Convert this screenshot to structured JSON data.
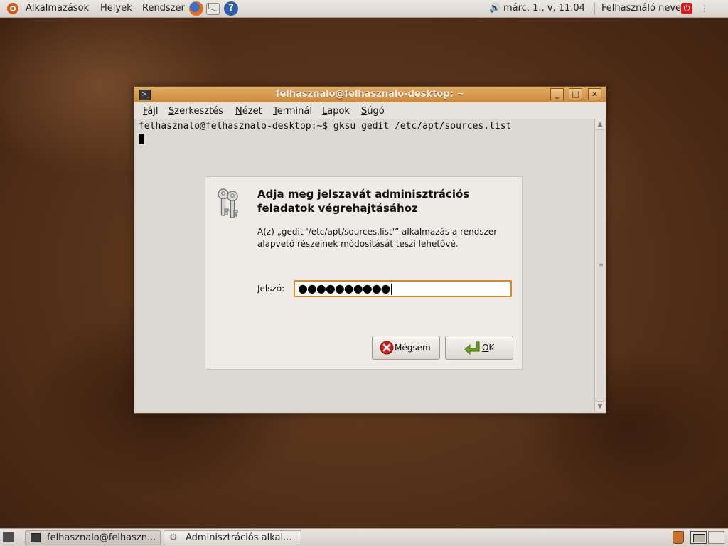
{
  "top_panel": {
    "applications": "Alkalmazások",
    "places": "Helyek",
    "system": "Rendszer",
    "clock": "márc.  1., v, 11.04",
    "user": "Felhasználó neve"
  },
  "terminal": {
    "title": "felhasznalo@felhasznalo-desktop: ~",
    "menu": [
      {
        "pre": "",
        "u": "F",
        "post": "ájl"
      },
      {
        "pre": "",
        "u": "S",
        "post": "zerkesztés"
      },
      {
        "pre": "",
        "u": "N",
        "post": "ézet"
      },
      {
        "pre": "",
        "u": "T",
        "post": "erminál"
      },
      {
        "pre": "",
        "u": "L",
        "post": "apok"
      },
      {
        "pre": "",
        "u": "S",
        "post": "úgó"
      }
    ],
    "command_line": "felhasznalo@felhasznalo-desktop:~$ gksu gedit /etc/apt/sources.list"
  },
  "dialog": {
    "title": "Adja meg jelszavát adminisztrációs feladatok végrehajtásához",
    "description": "A(z) „gedit '/etc/apt/sources.list'” alkalmazás a rendszer alapvető részeinek módosítását teszi lehetővé.",
    "password_label": "Jelszó:",
    "password_value": "●●●●●●●●●●",
    "cancel": {
      "pre": "Mé",
      "u": "g",
      "post": "sem"
    },
    "ok": {
      "pre": "",
      "u": "O",
      "post": "K"
    }
  },
  "bottom_panel": {
    "tasks": [
      "felhasznalo@felhaszn...",
      "Adminisztrációs alkal..."
    ]
  },
  "icons": {
    "menu_logo": "ubuntu-logo-icon",
    "launchers": [
      "firefox-icon",
      "mail-icon",
      "help-icon"
    ],
    "tray": [
      "volume-icon",
      "logout-icon"
    ],
    "dialog": "keys-icon"
  },
  "colors": {
    "titlebar": "#d69c52",
    "focus_ring": "#d58a2a",
    "cancel_icon": "#cc1e1e",
    "ok_icon": "#6aa51f"
  }
}
